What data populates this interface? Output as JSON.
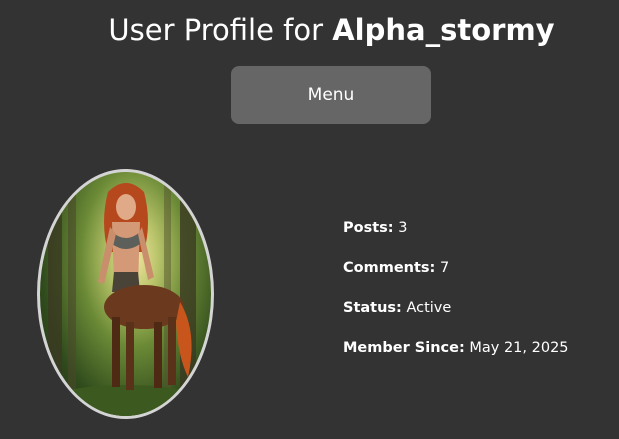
{
  "header": {
    "title_prefix": "User Profile for ",
    "username": "Alpha_stormy"
  },
  "menu": {
    "label": "Menu"
  },
  "avatar": {
    "description_icon": "centaur-portrait",
    "border_color": "#d4d4d4"
  },
  "stats": [
    {
      "label": "Posts:",
      "value": "3"
    },
    {
      "label": "Comments:",
      "value": "7"
    },
    {
      "label": "Status:",
      "value": "Active"
    },
    {
      "label": "Member Since:",
      "value": "May 21, 2025"
    }
  ],
  "colors": {
    "background": "#333333",
    "button": "#666666",
    "text": "#ffffff"
  }
}
